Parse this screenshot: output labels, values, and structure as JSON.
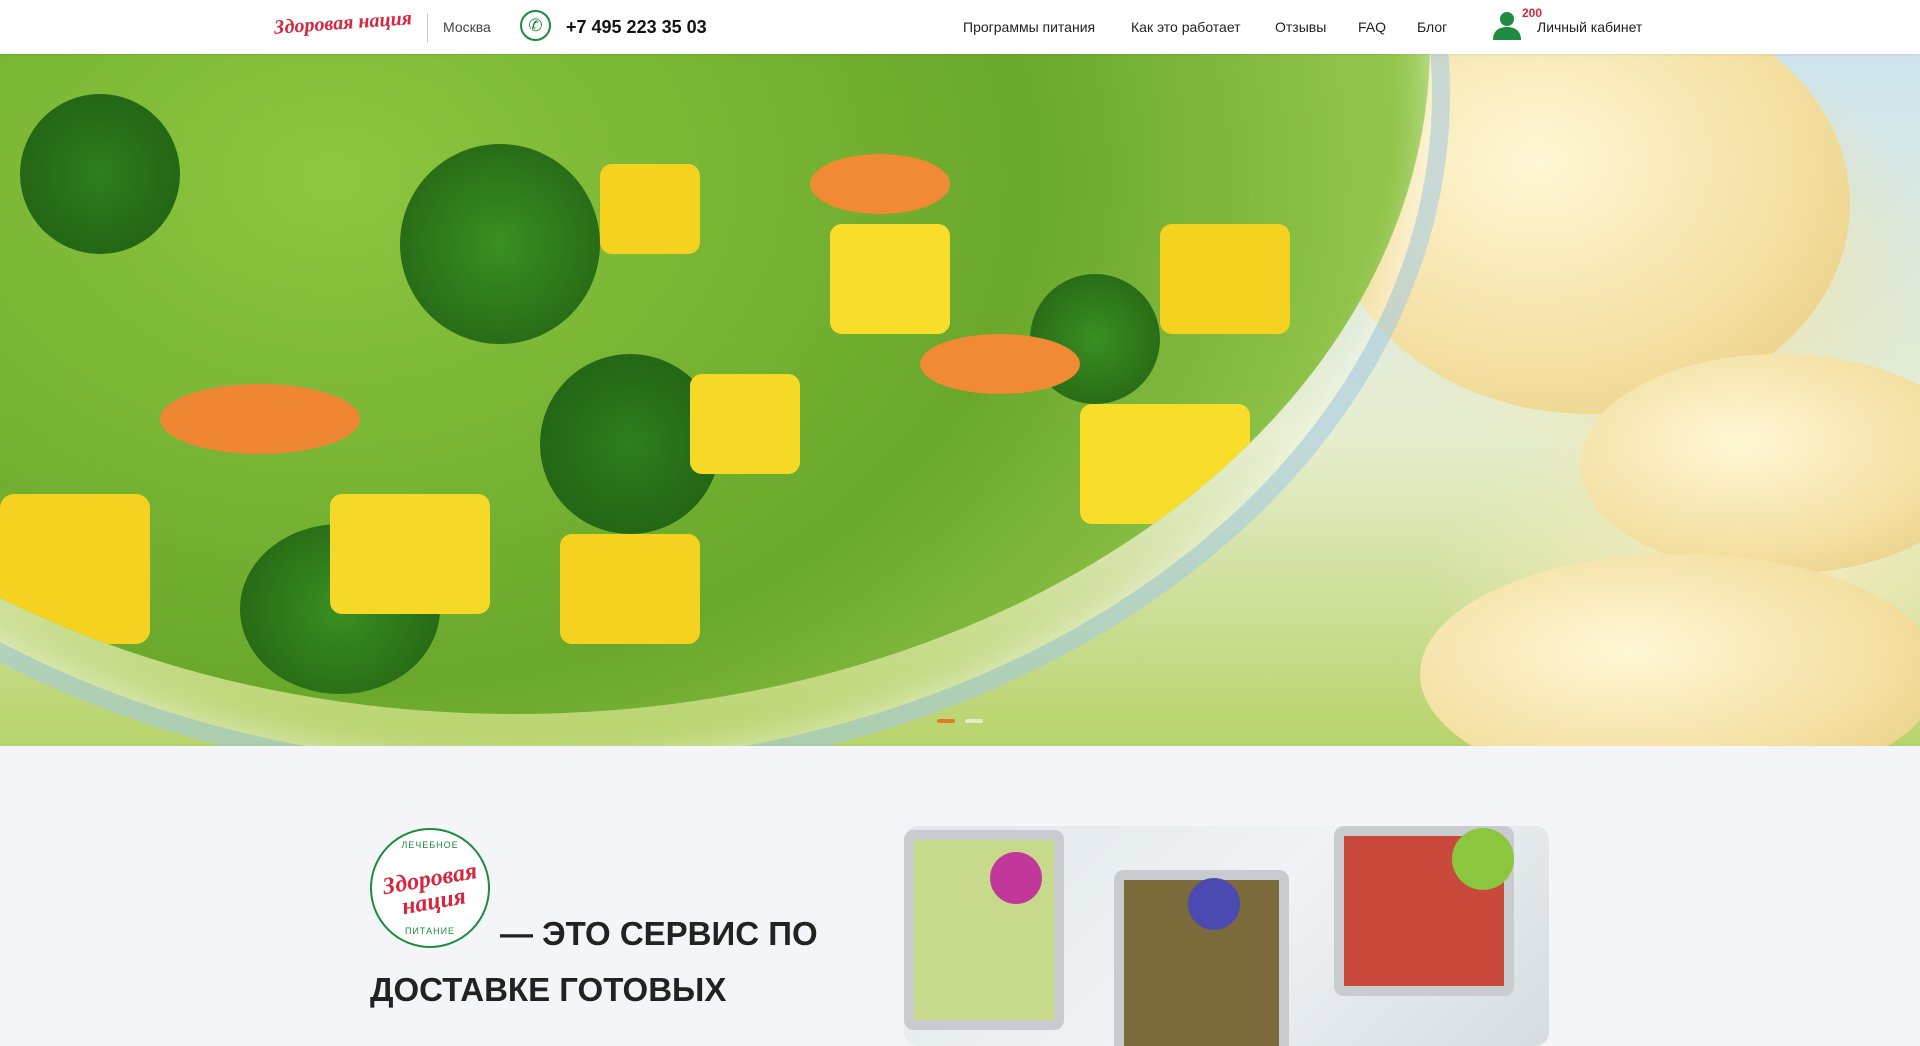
{
  "header": {
    "logo_text": "Здоровая нация",
    "city": "Москва",
    "phone": "+7 495 223 35 03",
    "nav": [
      {
        "label": "Программы питания"
      },
      {
        "label": "Как это работает"
      },
      {
        "label": "Отзывы"
      },
      {
        "label": "FAQ"
      },
      {
        "label": "Блог"
      }
    ],
    "account": {
      "badge": "200",
      "label": "Личный кабинет"
    }
  },
  "hero": {
    "slides_count": 3,
    "active_slide": 1
  },
  "about": {
    "stamp": {
      "top_text": "ЛЕЧЕБНОЕ",
      "name": "Здоровая нация",
      "bottom_text": "ПИТАНИЕ"
    },
    "headline_line1": "— это сервис по",
    "headline_line2": "доставке готовых"
  },
  "colors": {
    "brand_red": "#d7263d",
    "brand_green": "#1e8b3e",
    "slider_active": "#e07a27"
  },
  "icons": {
    "phone": "phone-icon",
    "account": "user-icon"
  }
}
